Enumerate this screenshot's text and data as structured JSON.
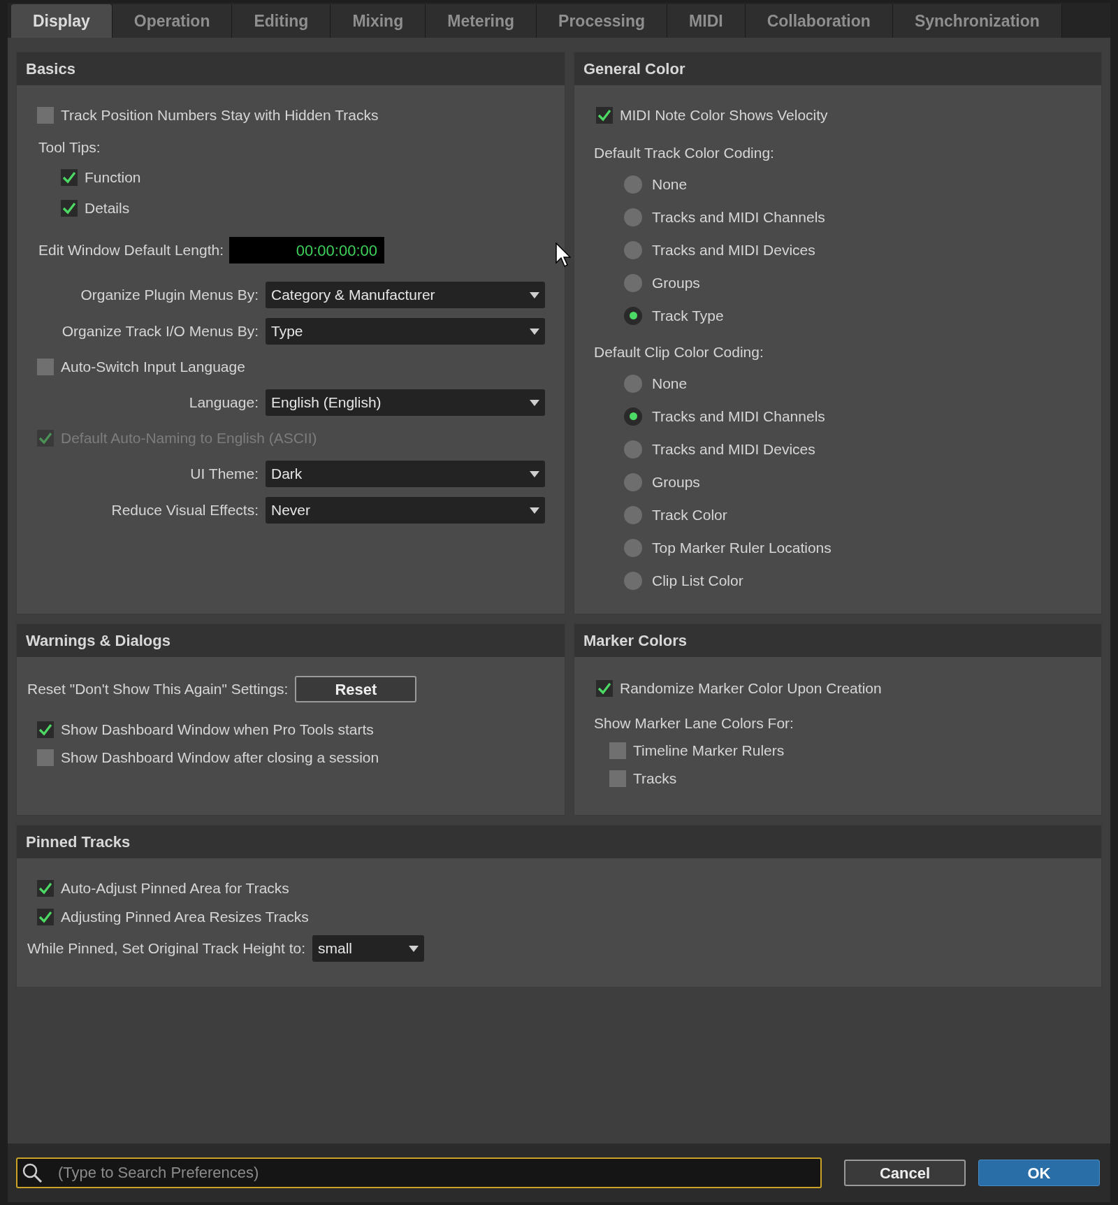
{
  "tabs": [
    {
      "label": "Display",
      "selected": true
    },
    {
      "label": "Operation",
      "selected": false
    },
    {
      "label": "Editing",
      "selected": false
    },
    {
      "label": "Mixing",
      "selected": false
    },
    {
      "label": "Metering",
      "selected": false
    },
    {
      "label": "Processing",
      "selected": false
    },
    {
      "label": "MIDI",
      "selected": false
    },
    {
      "label": "Collaboration",
      "selected": false
    },
    {
      "label": "Synchronization",
      "selected": false
    }
  ],
  "basics": {
    "title": "Basics",
    "items": [
      {
        "kind": "checkbox",
        "label": "Track Position Numbers Stay with Hidden Tracks",
        "checked": false,
        "disabled": false
      },
      {
        "kind": "group",
        "label": "Tool Tips:",
        "children": [
          {
            "label": "Function",
            "checked": true
          },
          {
            "label": "Details",
            "checked": true
          }
        ]
      },
      {
        "kind": "timecode",
        "label": "Edit Window Default Length:",
        "value": "00:00:00:00"
      },
      {
        "kind": "select",
        "label": "Organize Plugin Menus By:",
        "value": "Category & Manufacturer"
      },
      {
        "kind": "select",
        "label": "Organize Track I/O Menus By:",
        "value": "Type"
      },
      {
        "kind": "checkbox",
        "label": "Auto-Switch Input Language",
        "checked": false,
        "disabled": false
      },
      {
        "kind": "select",
        "label": "Language:",
        "value": "English (English)"
      },
      {
        "kind": "checkbox",
        "label": "Default Auto-Naming to English (ASCII)",
        "checked": true,
        "disabled": true
      },
      {
        "kind": "select",
        "label": "UI Theme:",
        "value": "Dark"
      },
      {
        "kind": "select",
        "label": "Reduce Visual Effects:",
        "value": "Never"
      }
    ]
  },
  "general_color": {
    "title": "General Color",
    "velocity": {
      "label": "MIDI Note Color Shows Velocity",
      "checked": true
    },
    "groups": [
      {
        "label": "Default Track Color Coding:",
        "options": [
          {
            "label": "None",
            "selected": false
          },
          {
            "label": "Tracks and MIDI Channels",
            "selected": false
          },
          {
            "label": "Tracks and MIDI Devices",
            "selected": false
          },
          {
            "label": "Groups",
            "selected": false
          },
          {
            "label": "Track Type",
            "selected": true
          }
        ]
      },
      {
        "label": "Default Clip Color Coding:",
        "options": [
          {
            "label": "None",
            "selected": false
          },
          {
            "label": "Tracks and MIDI Channels",
            "selected": true
          },
          {
            "label": "Tracks and MIDI Devices",
            "selected": false
          },
          {
            "label": "Groups",
            "selected": false
          },
          {
            "label": "Track Color",
            "selected": false
          },
          {
            "label": "Top Marker Ruler Locations",
            "selected": false
          },
          {
            "label": "Clip List Color",
            "selected": false
          }
        ]
      }
    ]
  },
  "warnings": {
    "title": "Warnings & Dialogs",
    "reset_label": "Reset \"Don't Show This Again\" Settings:",
    "reset_button": "Reset",
    "checkboxes": [
      {
        "label": "Show Dashboard Window when Pro Tools starts",
        "checked": true
      },
      {
        "label": "Show Dashboard Window after closing a session",
        "checked": false
      }
    ]
  },
  "marker_colors": {
    "title": "Marker Colors",
    "randomize": {
      "label": "Randomize Marker Color Upon Creation",
      "checked": true
    },
    "lane_label": "Show Marker Lane Colors For:",
    "lanes": [
      {
        "label": "Timeline Marker Rulers",
        "checked": false
      },
      {
        "label": "Tracks",
        "checked": false
      }
    ]
  },
  "pinned": {
    "title": "Pinned Tracks",
    "checkboxes": [
      {
        "label": "Auto-Adjust Pinned Area for Tracks",
        "checked": true
      },
      {
        "label": "Adjusting Pinned Area Resizes Tracks",
        "checked": true
      }
    ],
    "height": {
      "label": "While Pinned, Set Original Track Height to:",
      "value": "small"
    }
  },
  "search": {
    "placeholder": "(Type to Search Preferences)"
  },
  "buttons": {
    "cancel": "Cancel",
    "ok": "OK"
  }
}
